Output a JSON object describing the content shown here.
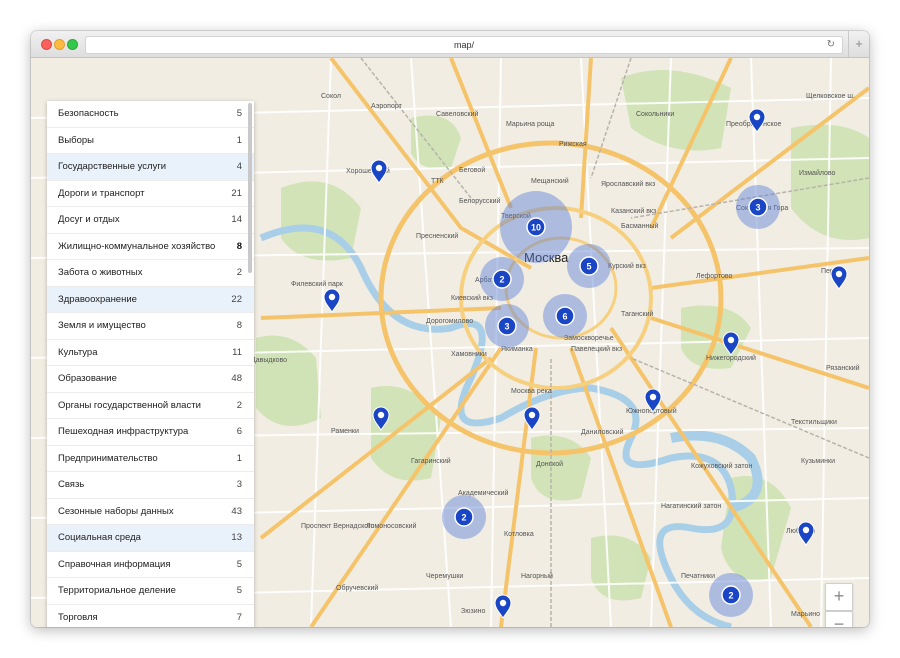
{
  "browser": {
    "url": "map/",
    "reload_icon": "reload-icon",
    "new_tab_label": "+"
  },
  "map": {
    "city_label": "Москва",
    "labels": [
      "Сокол",
      "Аэропорт",
      "Савеловский",
      "Марьина роща",
      "Рижская",
      "Сокольники",
      "Преображенское",
      "Щелковское ш.",
      "Хорошевский",
      "ТТК",
      "Беговой",
      "Белорусский",
      "Мещанский",
      "Ярославский вкз",
      "Казанский вкз",
      "Басманный",
      "Соколиная Гора",
      "Измайлово",
      "Тверской",
      "Пресненский",
      "Курский вкз",
      "Лефортово",
      "Перово",
      "Филевский парк",
      "Арбат",
      "Киевский вкз",
      "Дорогомилово",
      "Замоскворечье",
      "Таганский",
      "Хамовники",
      "Якиманка",
      "Павелецкий вкз",
      "Нижегородский",
      "Рязанский",
      "Давыдково",
      "Раменки",
      "Гагаринский",
      "Донской",
      "Даниловский",
      "Южнопортовый",
      "Текстильщики",
      "Кузьминки",
      "Академический",
      "Котловка",
      "Нагатинский затон",
      "Проспект Вернадского",
      "Ломоносовский",
      "Черемушки",
      "Нагорный",
      "Обручевский",
      "Зюзино",
      "Печатники",
      "Люблино",
      "Марьино",
      "Коньково",
      "Братеево",
      "Кожуховский затон",
      "Москва река"
    ],
    "clusters": [
      {
        "count": "10",
        "label_icon": "cluster-icon"
      },
      {
        "count": "5",
        "label_icon": "cluster-icon"
      },
      {
        "count": "2",
        "label_icon": "cluster-icon"
      },
      {
        "count": "3",
        "label_icon": "cluster-icon"
      },
      {
        "count": "6",
        "label_icon": "cluster-icon"
      },
      {
        "count": "3",
        "label_icon": "cluster-icon"
      },
      {
        "count": "2",
        "label_icon": "cluster-icon"
      },
      {
        "count": "2",
        "label_icon": "cluster-icon"
      }
    ],
    "pin_icon": "map-pin-icon",
    "zoom_in": "+",
    "zoom_out": "−"
  },
  "categories": [
    {
      "label": "Безопасность",
      "count": "5",
      "highlight": false,
      "bold": false
    },
    {
      "label": "Выборы",
      "count": "1",
      "highlight": false,
      "bold": false
    },
    {
      "label": "Государственные услуги",
      "count": "4",
      "highlight": true,
      "bold": false
    },
    {
      "label": "Дороги и транспорт",
      "count": "21",
      "highlight": false,
      "bold": false
    },
    {
      "label": "Досуг и отдых",
      "count": "14",
      "highlight": false,
      "bold": false
    },
    {
      "label": "Жилищно-коммунальное хозяйство",
      "count": "8",
      "highlight": false,
      "bold": true
    },
    {
      "label": "Забота о животных",
      "count": "2",
      "highlight": false,
      "bold": false
    },
    {
      "label": "Здравоохранение",
      "count": "22",
      "highlight": true,
      "bold": false
    },
    {
      "label": "Земля и имущество",
      "count": "8",
      "highlight": false,
      "bold": false
    },
    {
      "label": "Культура",
      "count": "11",
      "highlight": false,
      "bold": false
    },
    {
      "label": "Образование",
      "count": "48",
      "highlight": false,
      "bold": false
    },
    {
      "label": "Органы государственной власти",
      "count": "2",
      "highlight": false,
      "bold": false
    },
    {
      "label": "Пешеходная инфраструктура",
      "count": "6",
      "highlight": false,
      "bold": false
    },
    {
      "label": "Предпринимательство",
      "count": "1",
      "highlight": false,
      "bold": false
    },
    {
      "label": "Связь",
      "count": "3",
      "highlight": false,
      "bold": false
    },
    {
      "label": "Сезонные наборы данных",
      "count": "43",
      "highlight": false,
      "bold": false
    },
    {
      "label": "Социальная среда",
      "count": "13",
      "highlight": true,
      "bold": false
    },
    {
      "label": "Справочная информация",
      "count": "5",
      "highlight": false,
      "bold": false
    },
    {
      "label": "Территориальное деление",
      "count": "5",
      "highlight": false,
      "bold": false
    },
    {
      "label": "Торговля",
      "count": "7",
      "highlight": false,
      "bold": false
    }
  ]
}
